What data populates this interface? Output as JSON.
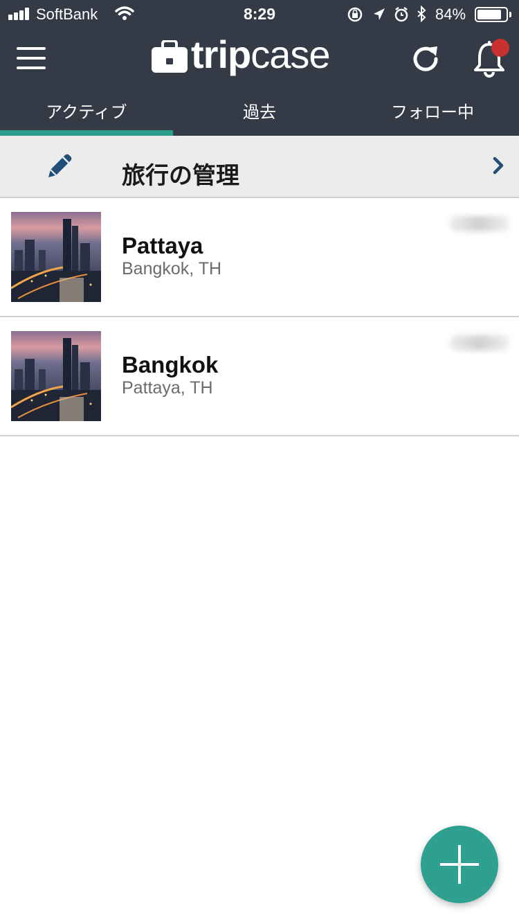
{
  "status_bar": {
    "carrier": "SoftBank",
    "time": "8:29",
    "battery_percent": "84%",
    "battery_level": 0.84
  },
  "app_bar": {
    "logo": "tripcase",
    "notification_badge": true
  },
  "tabs": [
    {
      "label": "アクティブ",
      "active": true
    },
    {
      "label": "過去",
      "active": false
    },
    {
      "label": "フォロー中",
      "active": false
    }
  ],
  "manage": {
    "label": "旅行の管理"
  },
  "trips": [
    {
      "title": "Pattaya",
      "subtitle": "Bangkok, TH"
    },
    {
      "title": "Bangkok",
      "subtitle": "Pattaya, TH"
    }
  ],
  "colors": {
    "header_bg": "#343b47",
    "accent": "#2ea08f",
    "notification_dot": "#c8312d",
    "manage_bg": "#ececec"
  },
  "icons": [
    "menu-icon",
    "refresh-icon",
    "bell-icon",
    "pencil-icon",
    "chevron-right-icon",
    "plus-icon"
  ]
}
